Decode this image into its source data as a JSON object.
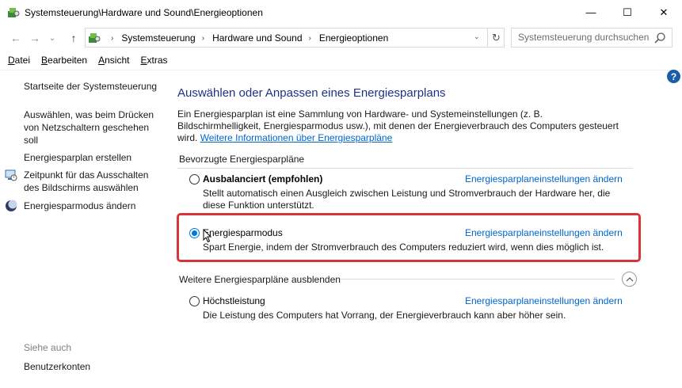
{
  "window": {
    "title": "Systemsteuerung\\Hardware und Sound\\Energieoptionen",
    "minimize_glyph": "—",
    "maximize_glyph": "☐",
    "close_glyph": "✕"
  },
  "navigation": {
    "back_glyph": "←",
    "forward_glyph": "→",
    "recent_glyph": "⌄",
    "up_glyph": "↑",
    "breadcrumbs": [
      "Systemsteuerung",
      "Hardware und Sound",
      "Energieoptionen"
    ],
    "refresh_glyph": "↻",
    "search_placeholder": "Systemsteuerung durchsuchen"
  },
  "menu": {
    "items": [
      {
        "accel": "D",
        "rest": "atei"
      },
      {
        "accel": "B",
        "rest": "earbeiten"
      },
      {
        "accel": "A",
        "rest": "nsicht"
      },
      {
        "accel": "E",
        "rest": "xtras"
      }
    ]
  },
  "help_label": "?",
  "sidebar": {
    "home": "Startseite der Systemsteuerung",
    "links": [
      "Auswählen, was beim Drücken von Netzschaltern geschehen soll",
      "Energiesparplan erstellen",
      "Zeitpunkt für das Ausschalten des Bildschirms auswählen",
      "Energiesparmodus ändern"
    ],
    "see_also": "Siehe auch",
    "see_also_links": [
      "Benutzerkonten"
    ]
  },
  "main": {
    "title": "Auswählen oder Anpassen eines Energiesparplans",
    "intro": "Ein Energiesparplan ist eine Sammlung von Hardware- und Systemeinstellungen (z. B. Bildschirmhelligkeit, Energiesparmodus usw.), mit denen der Energieverbrauch des Computers gesteuert wird.",
    "intro_link": "Weitere Informationen über Energiesparpläne",
    "preferred_label": "Bevorzugte Energiesparpläne",
    "more_label": "Weitere Energiesparpläne ausblenden",
    "settings_link": "Energiesparplaneinstellungen ändern",
    "plans": [
      {
        "name": "Ausbalanciert (empfohlen)",
        "selected": false,
        "description": "Stellt automatisch einen Ausgleich zwischen Leistung und Stromverbrauch der Hardware her, die diese Funktion unterstützt."
      },
      {
        "name": "Energiesparmodus",
        "selected": true,
        "description": "Spart Energie, indem der Stromverbrauch des Computers reduziert wird, wenn dies möglich ist."
      },
      {
        "name": "Höchstleistung",
        "selected": false,
        "description": "Die Leistung des Computers hat Vorrang, der Energieverbrauch kann aber höher sein."
      }
    ]
  },
  "colors": {
    "title_blue": "#1e3287",
    "link_blue": "#0066cc",
    "highlight_red": "#d9333b",
    "radio_blue": "#0078d7"
  }
}
